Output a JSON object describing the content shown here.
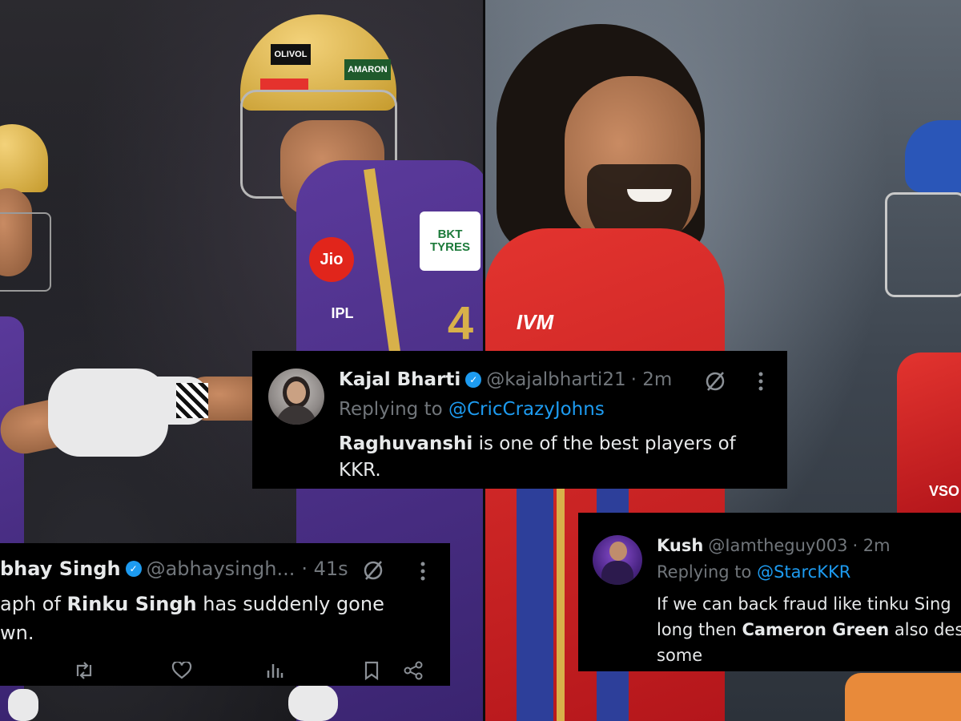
{
  "photos": {
    "left": {
      "helmet_text_1": "OLIVOL",
      "helmet_text_2": "AMARON",
      "sponsor_1": "Jio",
      "sponsor_2": "BKT TYRES",
      "logo": "IPL",
      "jersey_number": "4"
    },
    "right": {
      "sponsor": "IVM",
      "partial_text": "VSO"
    }
  },
  "tweets": [
    {
      "name": "Kajal Bharti",
      "handle": "@kajalbharti21",
      "time": "· 2m",
      "replying_prefix": "Replying to ",
      "replying_to": "@CricCrazyJohns",
      "body_bold": "Raghuvanshi",
      "body_rest_1": " is one of the best players of",
      "body_line2": "KKR."
    },
    {
      "name": "bhay Singh",
      "handle": "@abhaysingh...",
      "time": "· 41s",
      "line1_pre": "aph of ",
      "line1_bold": "Rinku Singh",
      "line1_post": " has suddenly gone",
      "line2": "wn."
    },
    {
      "name": "Kush",
      "handle": "@Iamtheguy003",
      "time": "· 2m",
      "replying_prefix": "Replying to ",
      "replying_to": "@StarcKKR",
      "line1": "If we can back fraud like tinku Sing",
      "line2_pre": "long then ",
      "line2_bold": "Cameron Green",
      "line2_post": " also dese",
      "line3": "some"
    }
  ],
  "icons": [
    "grok-icon",
    "more-icon",
    "retweet-icon",
    "like-icon",
    "views-icon",
    "bookmark-icon",
    "share-icon",
    "verified-icon"
  ]
}
